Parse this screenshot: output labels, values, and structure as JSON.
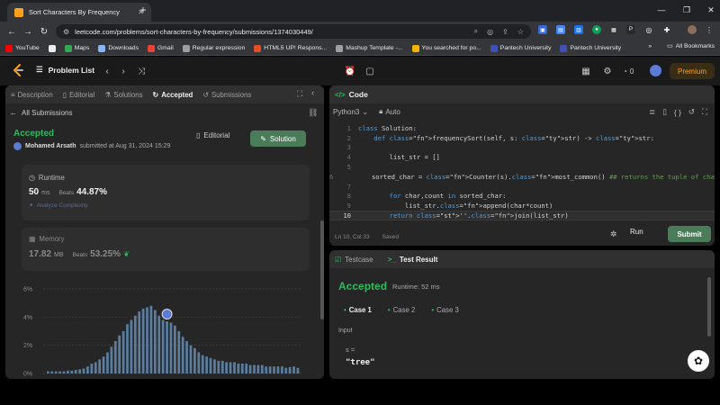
{
  "browser": {
    "tab_title": "Sort Characters By Frequency",
    "url": "leetcode.com/problems/sort-characters-by-frequency/submissions/1374030449/",
    "bookmarks": [
      {
        "label": "YouTube",
        "color": "#ff0000"
      },
      {
        "label": "",
        "color": "#eeeeee"
      },
      {
        "label": "Maps",
        "color": "#34a853"
      },
      {
        "label": "Downloads",
        "color": "#8ab4f8"
      },
      {
        "label": "Gmail",
        "color": "#ea4335"
      },
      {
        "label": "Regular expression",
        "color": "#9e9e9e"
      },
      {
        "label": "HTML5 UP! Respons...",
        "color": "#e44d26"
      },
      {
        "label": "Mashup Template -...",
        "color": "#9e9e9e"
      },
      {
        "label": "You searched for po...",
        "color": "#f4b400"
      },
      {
        "label": "Pantech University",
        "color": "#3f51b5"
      },
      {
        "label": "Pantech University",
        "color": "#3f51b5"
      }
    ],
    "bookmarks_more": "»",
    "all_bookmarks": "All Bookmarks"
  },
  "header": {
    "problem_list": "Problem List",
    "premium": "Premium",
    "fire_count": "0"
  },
  "left": {
    "tabs": [
      {
        "label": "Description",
        "icon": "≡"
      },
      {
        "label": "Editorial",
        "icon": "▯"
      },
      {
        "label": "Solutions",
        "icon": "⚗"
      },
      {
        "label": "Accepted",
        "icon": "↻"
      },
      {
        "label": "Submissions",
        "icon": "↺"
      }
    ],
    "back_label": "All Submissions",
    "status": "Accepted",
    "author_name": "Mohamed Arsath",
    "submitted_at": "submitted at Aug 31, 2024 15:29",
    "editorial_btn": "Editorial",
    "solution_btn": "Solution",
    "runtime": {
      "label": "Runtime",
      "value": "50",
      "unit": "ms",
      "beats_label": "Beats",
      "beats_pct": "44.87%",
      "analyze": "Analyze Complexity"
    },
    "memory": {
      "label": "Memory",
      "value": "17.82",
      "unit": "MB",
      "beats_label": "Beats",
      "beats_pct": "53.25%"
    }
  },
  "chart_data": {
    "type": "bar",
    "title": "",
    "xlabel": "",
    "ylabel": "",
    "y_ticks": [
      "6%",
      "4%",
      "2%",
      "0%"
    ],
    "ylim": [
      0,
      6
    ],
    "values": [
      0.15,
      0.15,
      0.15,
      0.15,
      0.15,
      0.2,
      0.2,
      0.25,
      0.3,
      0.35,
      0.5,
      0.7,
      0.8,
      1.0,
      1.2,
      1.5,
      1.9,
      2.3,
      2.7,
      3.0,
      3.5,
      3.8,
      4.1,
      4.4,
      4.6,
      4.7,
      4.8,
      4.5,
      4.1,
      3.8,
      3.7,
      3.6,
      3.4,
      3.0,
      2.6,
      2.3,
      2.0,
      1.8,
      1.5,
      1.3,
      1.2,
      1.1,
      1.0,
      0.9,
      0.9,
      0.8,
      0.8,
      0.8,
      0.7,
      0.7,
      0.7,
      0.6,
      0.6,
      0.6,
      0.6,
      0.5,
      0.5,
      0.5,
      0.5,
      0.5,
      0.4,
      0.45,
      0.5,
      0.4
    ],
    "highlight_index": 30,
    "bar_color": "#5b7ea0",
    "grid": true
  },
  "code": {
    "header": "Code",
    "language": "Python3",
    "mode": "Auto",
    "lines": [
      "class Solution:",
      "    def frequencySort(self, s: str) -> str:",
      "",
      "        list_str = []",
      "",
      "        sorted_char = Counter(s).most_common() ## returns the tuple of char and count",
      "",
      "        for char,count in sorted_char:",
      "            list_str.append(char*count)",
      "        return ''.join(list_str)"
    ],
    "cursor": "Ln 10, Col 33",
    "saved": "Saved",
    "run": "Run",
    "submit": "Submit"
  },
  "result": {
    "tabs": [
      {
        "label": "Testcase",
        "icon": "☑"
      },
      {
        "label": "Test Result",
        "icon": ">_"
      }
    ],
    "status": "Accepted",
    "runtime": "Runtime: 52 ms",
    "cases": [
      "Case 1",
      "Case 2",
      "Case 3"
    ],
    "input_label": "Input",
    "var_name": "s =",
    "var_value": "\"tree\""
  }
}
